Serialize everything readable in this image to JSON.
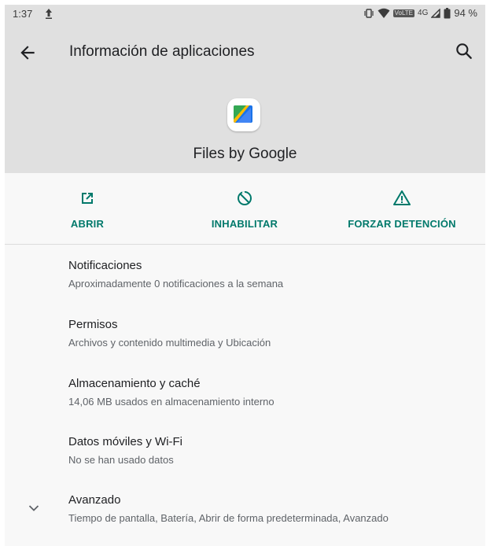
{
  "status_bar": {
    "time": "1:37",
    "network_label": "4G",
    "volte_label": "VoLTE",
    "battery": "94 %"
  },
  "header": {
    "title": "Información de aplicaciones",
    "app_name": "Files by Google"
  },
  "actions": [
    {
      "label": "ABRIR",
      "icon": "open-in-new-icon"
    },
    {
      "label": "INHABILITAR",
      "icon": "disable-icon"
    },
    {
      "label": "FORZAR DETENCIÓN",
      "icon": "warning-icon"
    }
  ],
  "settings": [
    {
      "title": "Notificaciones",
      "summary": "Aproximadamente 0 notificaciones a la semana"
    },
    {
      "title": "Permisos",
      "summary": "Archivos y contenido multimedia y Ubicación"
    },
    {
      "title": "Almacenamiento y caché",
      "summary": "14,06 MB usados en almacenamiento interno"
    },
    {
      "title": "Datos móviles y Wi-Fi",
      "summary": "No se han usado datos"
    },
    {
      "title": "Avanzado",
      "summary": "Tiempo de pantalla, Batería, Abrir de forma predeterminada, Avanzado"
    }
  ],
  "colors": {
    "accent": "#00796b",
    "header_bg": "#e0e0e0",
    "page_bg": "#f8f8f8"
  }
}
